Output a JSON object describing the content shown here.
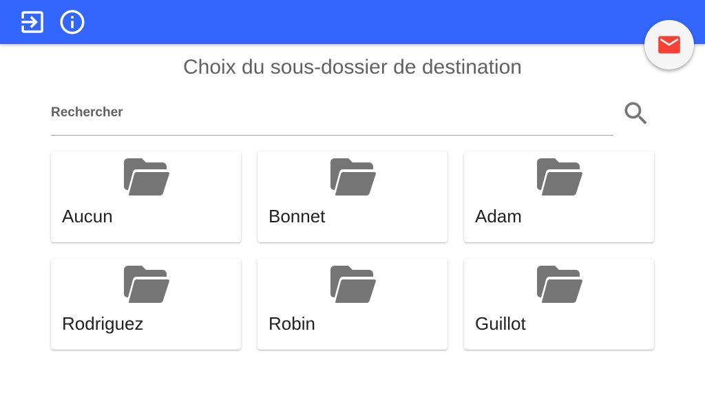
{
  "header": {
    "logout_icon": "exit-to-app-icon",
    "info_icon": "info-icon",
    "mail_icon": "email-icon",
    "mail_color": "#f44336",
    "bar_color": "#3366ff"
  },
  "main": {
    "title": "Choix du sous-dossier de destination",
    "search": {
      "placeholder": "Rechercher",
      "value": "",
      "icon": "search-icon"
    },
    "folders": [
      {
        "label": "Aucun",
        "icon": "folder-open-icon"
      },
      {
        "label": "Bonnet",
        "icon": "folder-open-icon"
      },
      {
        "label": "Adam",
        "icon": "folder-open-icon"
      },
      {
        "label": "Rodriguez",
        "icon": "folder-open-icon"
      },
      {
        "label": "Robin",
        "icon": "folder-open-icon"
      },
      {
        "label": "Guillot",
        "icon": "folder-open-icon"
      }
    ]
  }
}
